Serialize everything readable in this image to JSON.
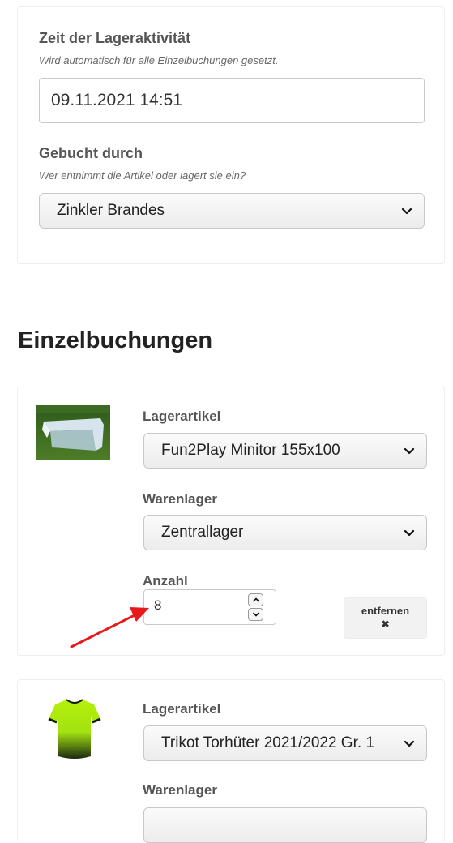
{
  "activity": {
    "time_label": "Zeit der Lageraktivität",
    "time_hint": "Wird automatisch für alle Einzelbuchungen gesetzt.",
    "time_value": "09.11.2021 14:51",
    "booked_by_label": "Gebucht durch",
    "booked_by_hint": "Wer entnimmt die Artikel oder lagert sie ein?",
    "booked_by_value": "Zinkler Brandes"
  },
  "bookings": {
    "title": "Einzelbuchungen",
    "items": [
      {
        "article_label": "Lagerartikel",
        "article_value": "Fun2Play Minitor 155x100",
        "warehouse_label": "Warenlager",
        "warehouse_value": "Zentrallager",
        "quantity_label": "Anzahl",
        "quantity_value": "8",
        "remove_label": "entfernen",
        "remove_icon": "✖"
      },
      {
        "article_label": "Lagerartikel",
        "article_value": "Trikot Torhüter 2021/2022 Gr. 1",
        "warehouse_label": "Warenlager"
      }
    ]
  },
  "colors": {
    "annotation_arrow": "#e8191c",
    "jersey": "#b5f00a"
  }
}
